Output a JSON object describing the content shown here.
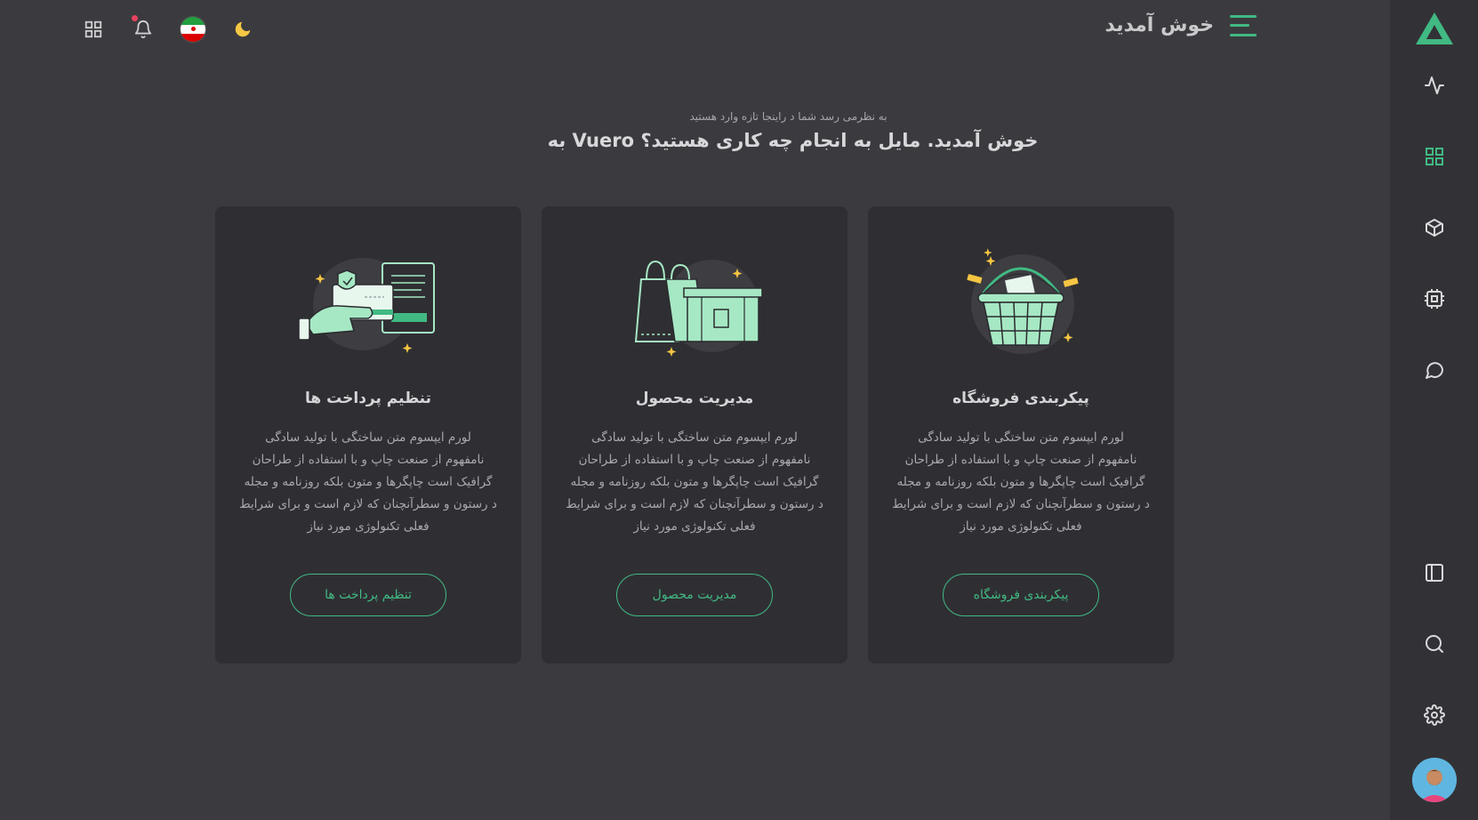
{
  "app": {
    "name": "Vuero"
  },
  "header": {
    "welcome_label": "خوش آمدید"
  },
  "top_actions": {
    "icons": [
      "apps-grid-icon",
      "bell-icon",
      "iran-flag-icon",
      "moon-icon"
    ]
  },
  "sidebar": {
    "items": [
      {
        "icon": "activity-icon",
        "active": false
      },
      {
        "icon": "grid-icon",
        "active": true
      },
      {
        "icon": "box-icon",
        "active": false
      },
      {
        "icon": "cpu-icon",
        "active": false
      },
      {
        "icon": "message-icon",
        "active": false
      }
    ],
    "bottom_items": [
      {
        "icon": "sidebar-layout-icon"
      },
      {
        "icon": "search-icon"
      },
      {
        "icon": "settings-icon"
      }
    ]
  },
  "hero": {
    "subtitle": "به نظرمی رسد شما د راینجا تازه وارد هستید",
    "title": "به Vuero خوش آمدید. مایل به انجام چه کاری هستید؟"
  },
  "cards": [
    {
      "title": "پیکربندی فروشگاه",
      "lines": [
        "لورم ایپسوم متن ساختگی با تولید سادگی",
        "نامفهوم از صنعت چاپ و با استفاده از طراحان",
        "گرافیک است چاپگرها و متون بلکه روزنامه و مجله",
        "د رستون و سطرآنچنان که لازم است و برای شرایط",
        "فعلی تکنولوژی مورد نیاز"
      ],
      "button": "پیکربندی فروشگاه"
    },
    {
      "title": "مدیریت محصول",
      "lines": [
        "لورم ایپسوم متن ساختگی با تولید سادگی",
        "نامفهوم از صنعت چاپ و با استفاده از طراحان",
        "گرافیک است چاپگرها و متون بلکه روزنامه و مجله",
        "د رستون و سطرآنچنان که لازم است و برای شرایط",
        "فعلی تکنولوژی مورد نیاز"
      ],
      "button": "مدیریت محصول"
    },
    {
      "title": "تنظیم پرداخت ها",
      "lines": [
        "لورم ایپسوم متن ساختگی با تولید سادگی",
        "نامفهوم از صنعت چاپ و با استفاده از طراحان",
        "گرافیک است چاپگرها و متون بلکه روزنامه و مجله",
        "د رستون و سطرآنچنان که لازم است و برای شرایط",
        "فعلی تکنولوژی مورد نیاز"
      ],
      "button": "تنظیم پرداخت ها"
    }
  ],
  "colors": {
    "accent": "#41b983",
    "background": "#3b3b3f",
    "card": "#2f2f33",
    "sidebar": "#323236"
  }
}
